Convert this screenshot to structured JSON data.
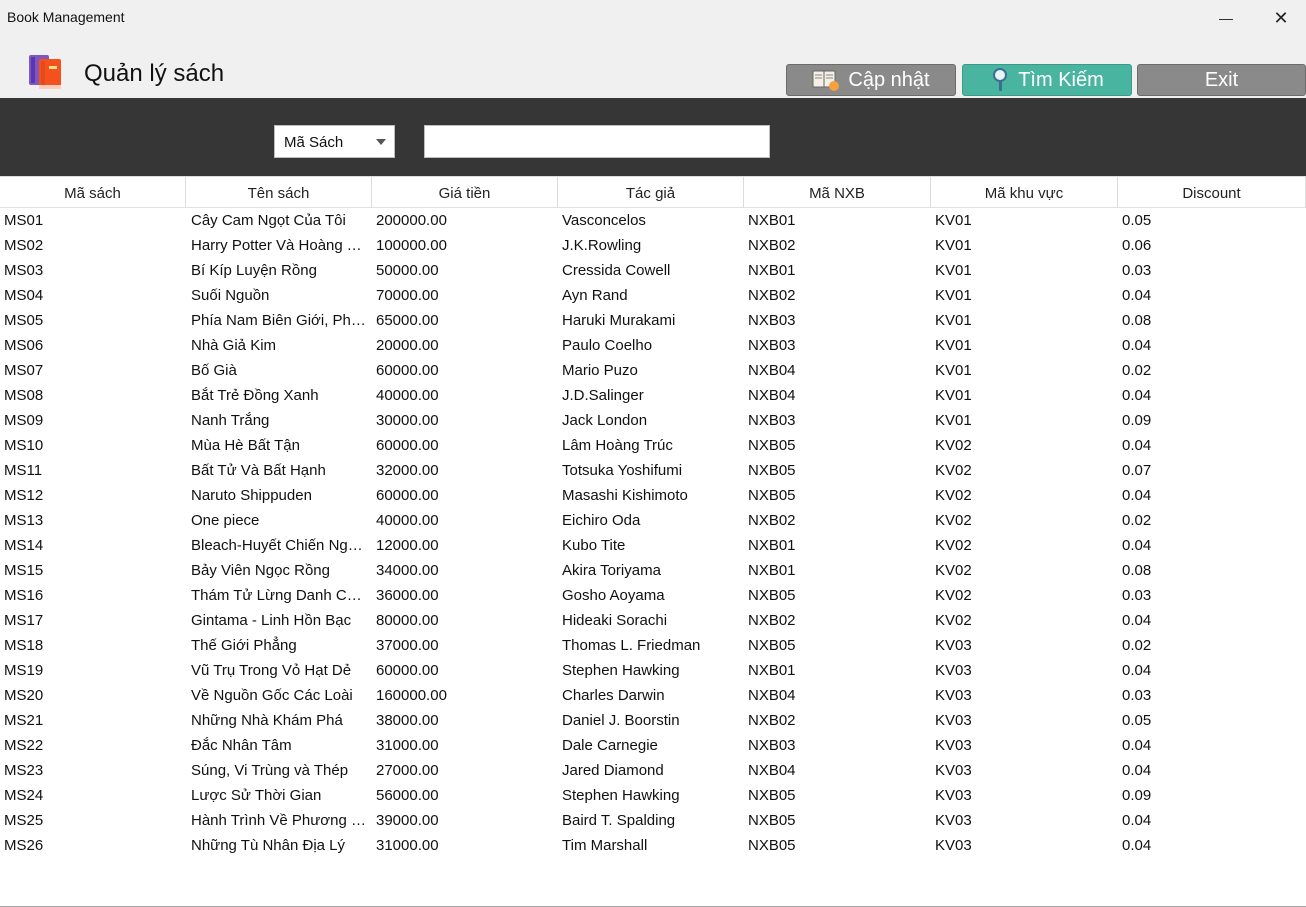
{
  "window": {
    "title": "Book Management",
    "minimize_glyph": "—",
    "close_glyph": "✕"
  },
  "header": {
    "title": "Quản lý sách",
    "logo_icon": "books-icon",
    "buttons": {
      "update": "Cập nhật",
      "search": "Tìm Kiếm",
      "exit": "Exit"
    },
    "colors": {
      "update": "#8a8a8a",
      "search": "#49b5a0",
      "exit": "#8a8a8a"
    }
  },
  "search": {
    "field_selected": "Mã Sách",
    "query": ""
  },
  "table": {
    "columns": [
      "Mã sách",
      "Tên sách",
      "Giá tiền",
      "Tác giả",
      "Mã NXB",
      "Mã khu vực",
      "Discount"
    ],
    "rows": [
      [
        "MS01",
        "Cây Cam Ngọt Của Tôi",
        "200000.00",
        "Vasconcelos",
        "NXB01",
        "KV01",
        "0.05"
      ],
      [
        "MS02",
        "Harry Potter Và Hoàng Tử Lai",
        "100000.00",
        "J.K.Rowling",
        "NXB02",
        "KV01",
        "0.06"
      ],
      [
        "MS03",
        "Bí Kíp Luyện Rồng",
        "50000.00",
        "Cressida Cowell",
        "NXB01",
        "KV01",
        "0.03"
      ],
      [
        "MS04",
        "Suối Nguồn",
        "70000.00",
        "Ayn Rand",
        "NXB02",
        "KV01",
        "0.04"
      ],
      [
        "MS05",
        "Phía Nam Biên Giới, Phía Tây Mặt Trời",
        "65000.00",
        "Haruki Murakami",
        "NXB03",
        "KV01",
        "0.08"
      ],
      [
        "MS06",
        "Nhà Giả Kim",
        "20000.00",
        "Paulo Coelho",
        "NXB03",
        "KV01",
        "0.04"
      ],
      [
        "MS07",
        "Bố Già",
        "60000.00",
        "Mario Puzo",
        "NXB04",
        "KV01",
        "0.02"
      ],
      [
        "MS08",
        "Bắt Trẻ Đồng Xanh",
        "40000.00",
        "J.D.Salinger",
        "NXB04",
        "KV01",
        "0.04"
      ],
      [
        "MS09",
        "Nanh Trắng",
        "30000.00",
        "Jack London",
        "NXB03",
        "KV01",
        "0.09"
      ],
      [
        "MS10",
        "Mùa Hè Bất Tận",
        "60000.00",
        "Lâm Hoàng Trúc",
        "NXB05",
        "KV02",
        "0.04"
      ],
      [
        "MS11",
        "Bất Tử Và Bất Hạnh",
        "32000.00",
        "Totsuka Yoshifumi",
        "NXB05",
        "KV02",
        "0.07"
      ],
      [
        "MS12",
        "Naruto Shippuden",
        "60000.00",
        "Masashi Kishimoto",
        "NXB05",
        "KV02",
        "0.04"
      ],
      [
        "MS13",
        "One piece",
        "40000.00",
        "Eichiro Oda",
        "NXB02",
        "KV02",
        "0.02"
      ],
      [
        "MS14",
        "Bleach-Huyết Chiến Ngàn Năm",
        "12000.00",
        "Kubo Tite",
        "NXB01",
        "KV02",
        "0.04"
      ],
      [
        "MS15",
        "Bảy Viên Ngọc Rồng",
        "34000.00",
        "Akira Toriyama",
        "NXB01",
        "KV02",
        "0.08"
      ],
      [
        "MS16",
        "Thám Tử Lừng Danh Conan",
        "36000.00",
        "Gosho Aoyama",
        "NXB05",
        "KV02",
        "0.03"
      ],
      [
        "MS17",
        "Gintama - Linh Hồn Bạc",
        "80000.00",
        "Hideaki Sorachi",
        "NXB02",
        "KV02",
        "0.04"
      ],
      [
        "MS18",
        "Thế Giới Phẳng",
        "37000.00",
        "Thomas L. Friedman",
        "NXB05",
        "KV03",
        "0.02"
      ],
      [
        "MS19",
        "Vũ Trụ Trong Vỏ Hạt Dẻ",
        "60000.00",
        "Stephen Hawking",
        "NXB01",
        "KV03",
        "0.04"
      ],
      [
        "MS20",
        "Về Nguồn Gốc Các Loài",
        "160000.00",
        "Charles Darwin",
        "NXB04",
        "KV03",
        "0.03"
      ],
      [
        "MS21",
        "Những Nhà Khám Phá",
        "38000.00",
        "Daniel J. Boorstin",
        "NXB02",
        "KV03",
        "0.05"
      ],
      [
        "MS22",
        "Đắc Nhân Tâm",
        "31000.00",
        "Dale Carnegie",
        "NXB03",
        "KV03",
        "0.04"
      ],
      [
        "MS23",
        "Súng, Vi Trùng và Thép",
        "27000.00",
        "Jared Diamond",
        "NXB04",
        "KV03",
        "0.04"
      ],
      [
        "MS24",
        "Lược Sử Thời Gian",
        "56000.00",
        "Stephen Hawking",
        "NXB05",
        "KV03",
        "0.09"
      ],
      [
        "MS25",
        "Hành Trình Về Phương Đông",
        "39000.00",
        "Baird T. Spalding",
        "NXB05",
        "KV03",
        "0.04"
      ],
      [
        "MS26",
        "Những Tù Nhân Địa Lý",
        "31000.00",
        "Tim Marshall",
        "NXB05",
        "KV03",
        "0.04"
      ]
    ]
  }
}
